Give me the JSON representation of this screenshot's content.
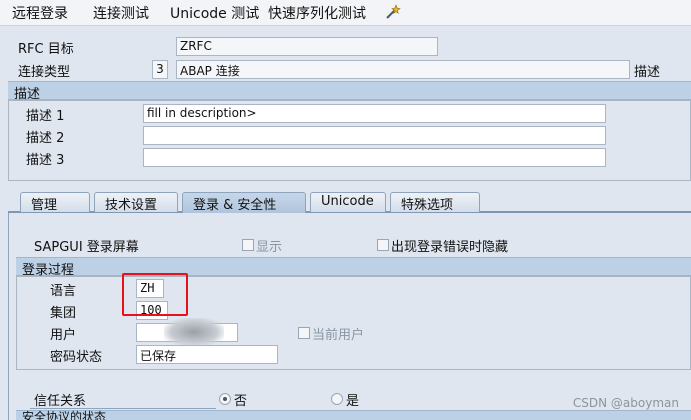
{
  "toolbar": {
    "items": [
      "远程登录",
      "连接测试",
      "Unicode 测试",
      "快速序列化测试"
    ],
    "tool_icon": "wand-icon"
  },
  "header": {
    "rfc_target_label": "RFC 目标",
    "rfc_target_value": "ZRFC",
    "conn_type_label": "连接类型",
    "conn_type_code": "3",
    "conn_type_value": "ABAP 连接",
    "conn_type_desc_label": "描述"
  },
  "description": {
    "title": "描述",
    "rows": [
      {
        "label": "描述 1",
        "value": "fill in description>"
      },
      {
        "label": "描述 2",
        "value": ""
      },
      {
        "label": "描述 3",
        "value": ""
      }
    ]
  },
  "tabs": [
    {
      "label": "管理",
      "active": false
    },
    {
      "label": "技术设置",
      "active": false
    },
    {
      "label": "登录 & 安全性",
      "active": true
    },
    {
      "label": "Unicode",
      "active": false
    },
    {
      "label": "特殊选项",
      "active": false
    }
  ],
  "logon": {
    "sapgui_label": "SAPGUI 登录屏幕",
    "show_label": "显示",
    "hide_errors_label": "出现登录错误时隐藏",
    "group_title": "登录过程",
    "language_label": "语言",
    "language_value": "ZH",
    "client_label": "集团",
    "client_value": "100",
    "user_label": "用户",
    "user_value": "",
    "current_user_label": "当前用户",
    "password_status_label": "密码状态",
    "password_status_value": "已保存",
    "trust_label": "信任关系",
    "trust_no": "否",
    "trust_yes": "是",
    "trust_selected": "否",
    "security_section_partial": "安全协议的状态"
  },
  "watermark": "CSDN @aboyman",
  "colors": {
    "background": "#dfe6ef",
    "group_header": "#bcd0e6",
    "highlight_box": "#e8101a"
  }
}
